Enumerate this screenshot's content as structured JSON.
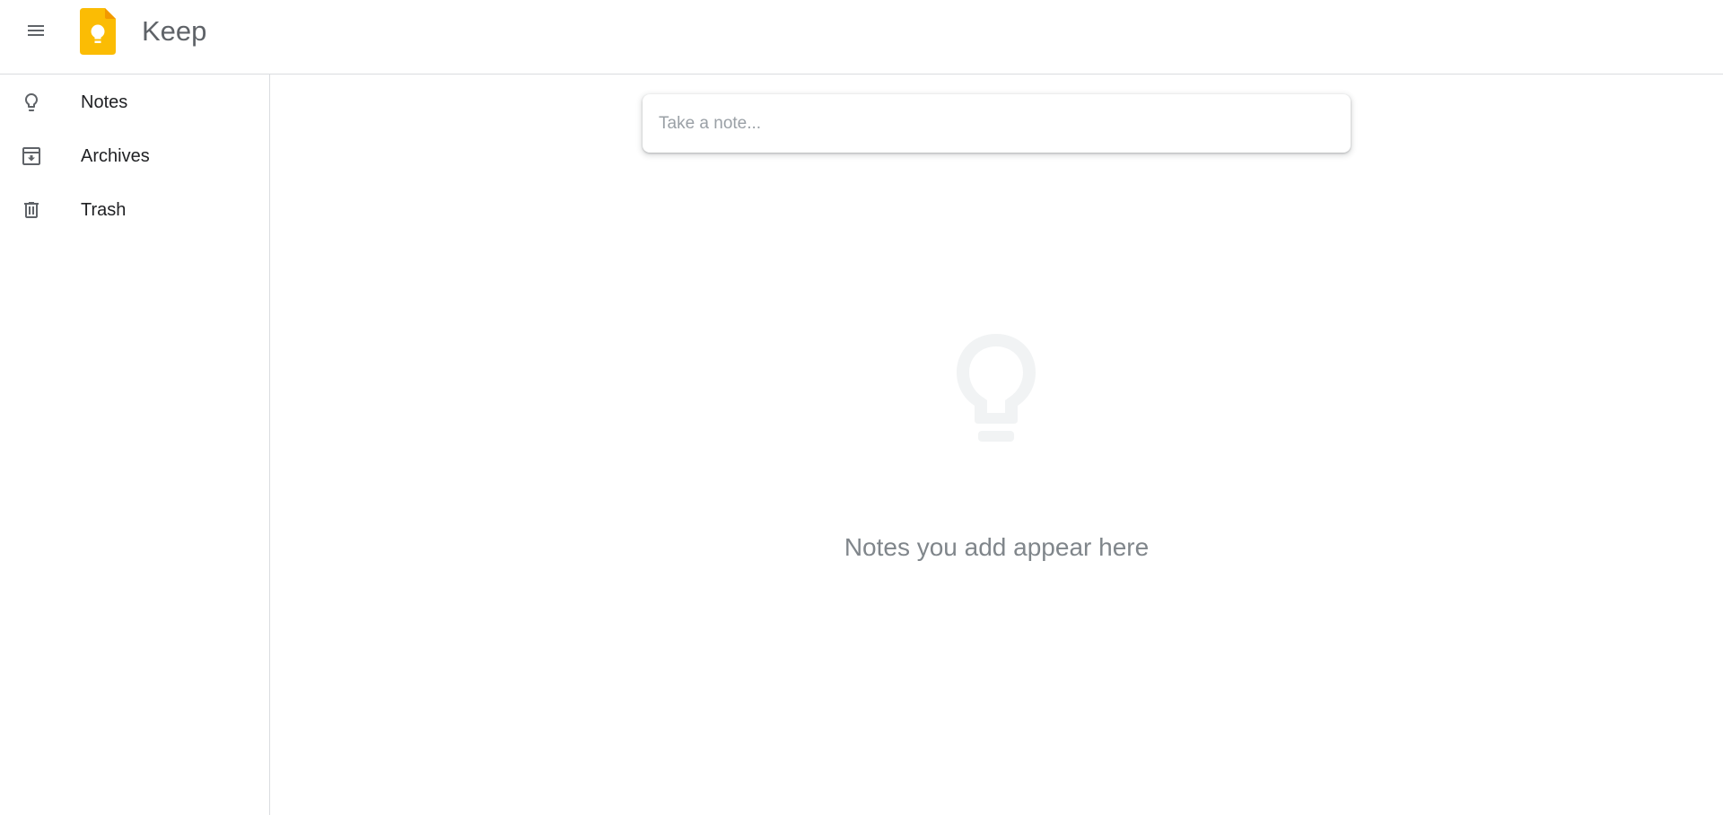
{
  "header": {
    "app_title": "Keep",
    "menu_icon": "hamburger-menu-icon",
    "logo_icon": "keep-logo-icon",
    "logo_color": "#FBBC04"
  },
  "sidebar": {
    "items": [
      {
        "label": "Notes",
        "icon": "lightbulb-icon"
      },
      {
        "label": "Archives",
        "icon": "archive-icon"
      },
      {
        "label": "Trash",
        "icon": "trash-icon"
      }
    ]
  },
  "main": {
    "note_input": {
      "placeholder": "Take a note...",
      "value": ""
    },
    "empty_state": {
      "icon": "lightbulb-icon",
      "text": "Notes you add appear here"
    }
  },
  "colors": {
    "border": "#dadce0",
    "icon_gray": "#5f6368",
    "empty_icon": "#f1f3f4",
    "empty_text": "#80868b"
  }
}
